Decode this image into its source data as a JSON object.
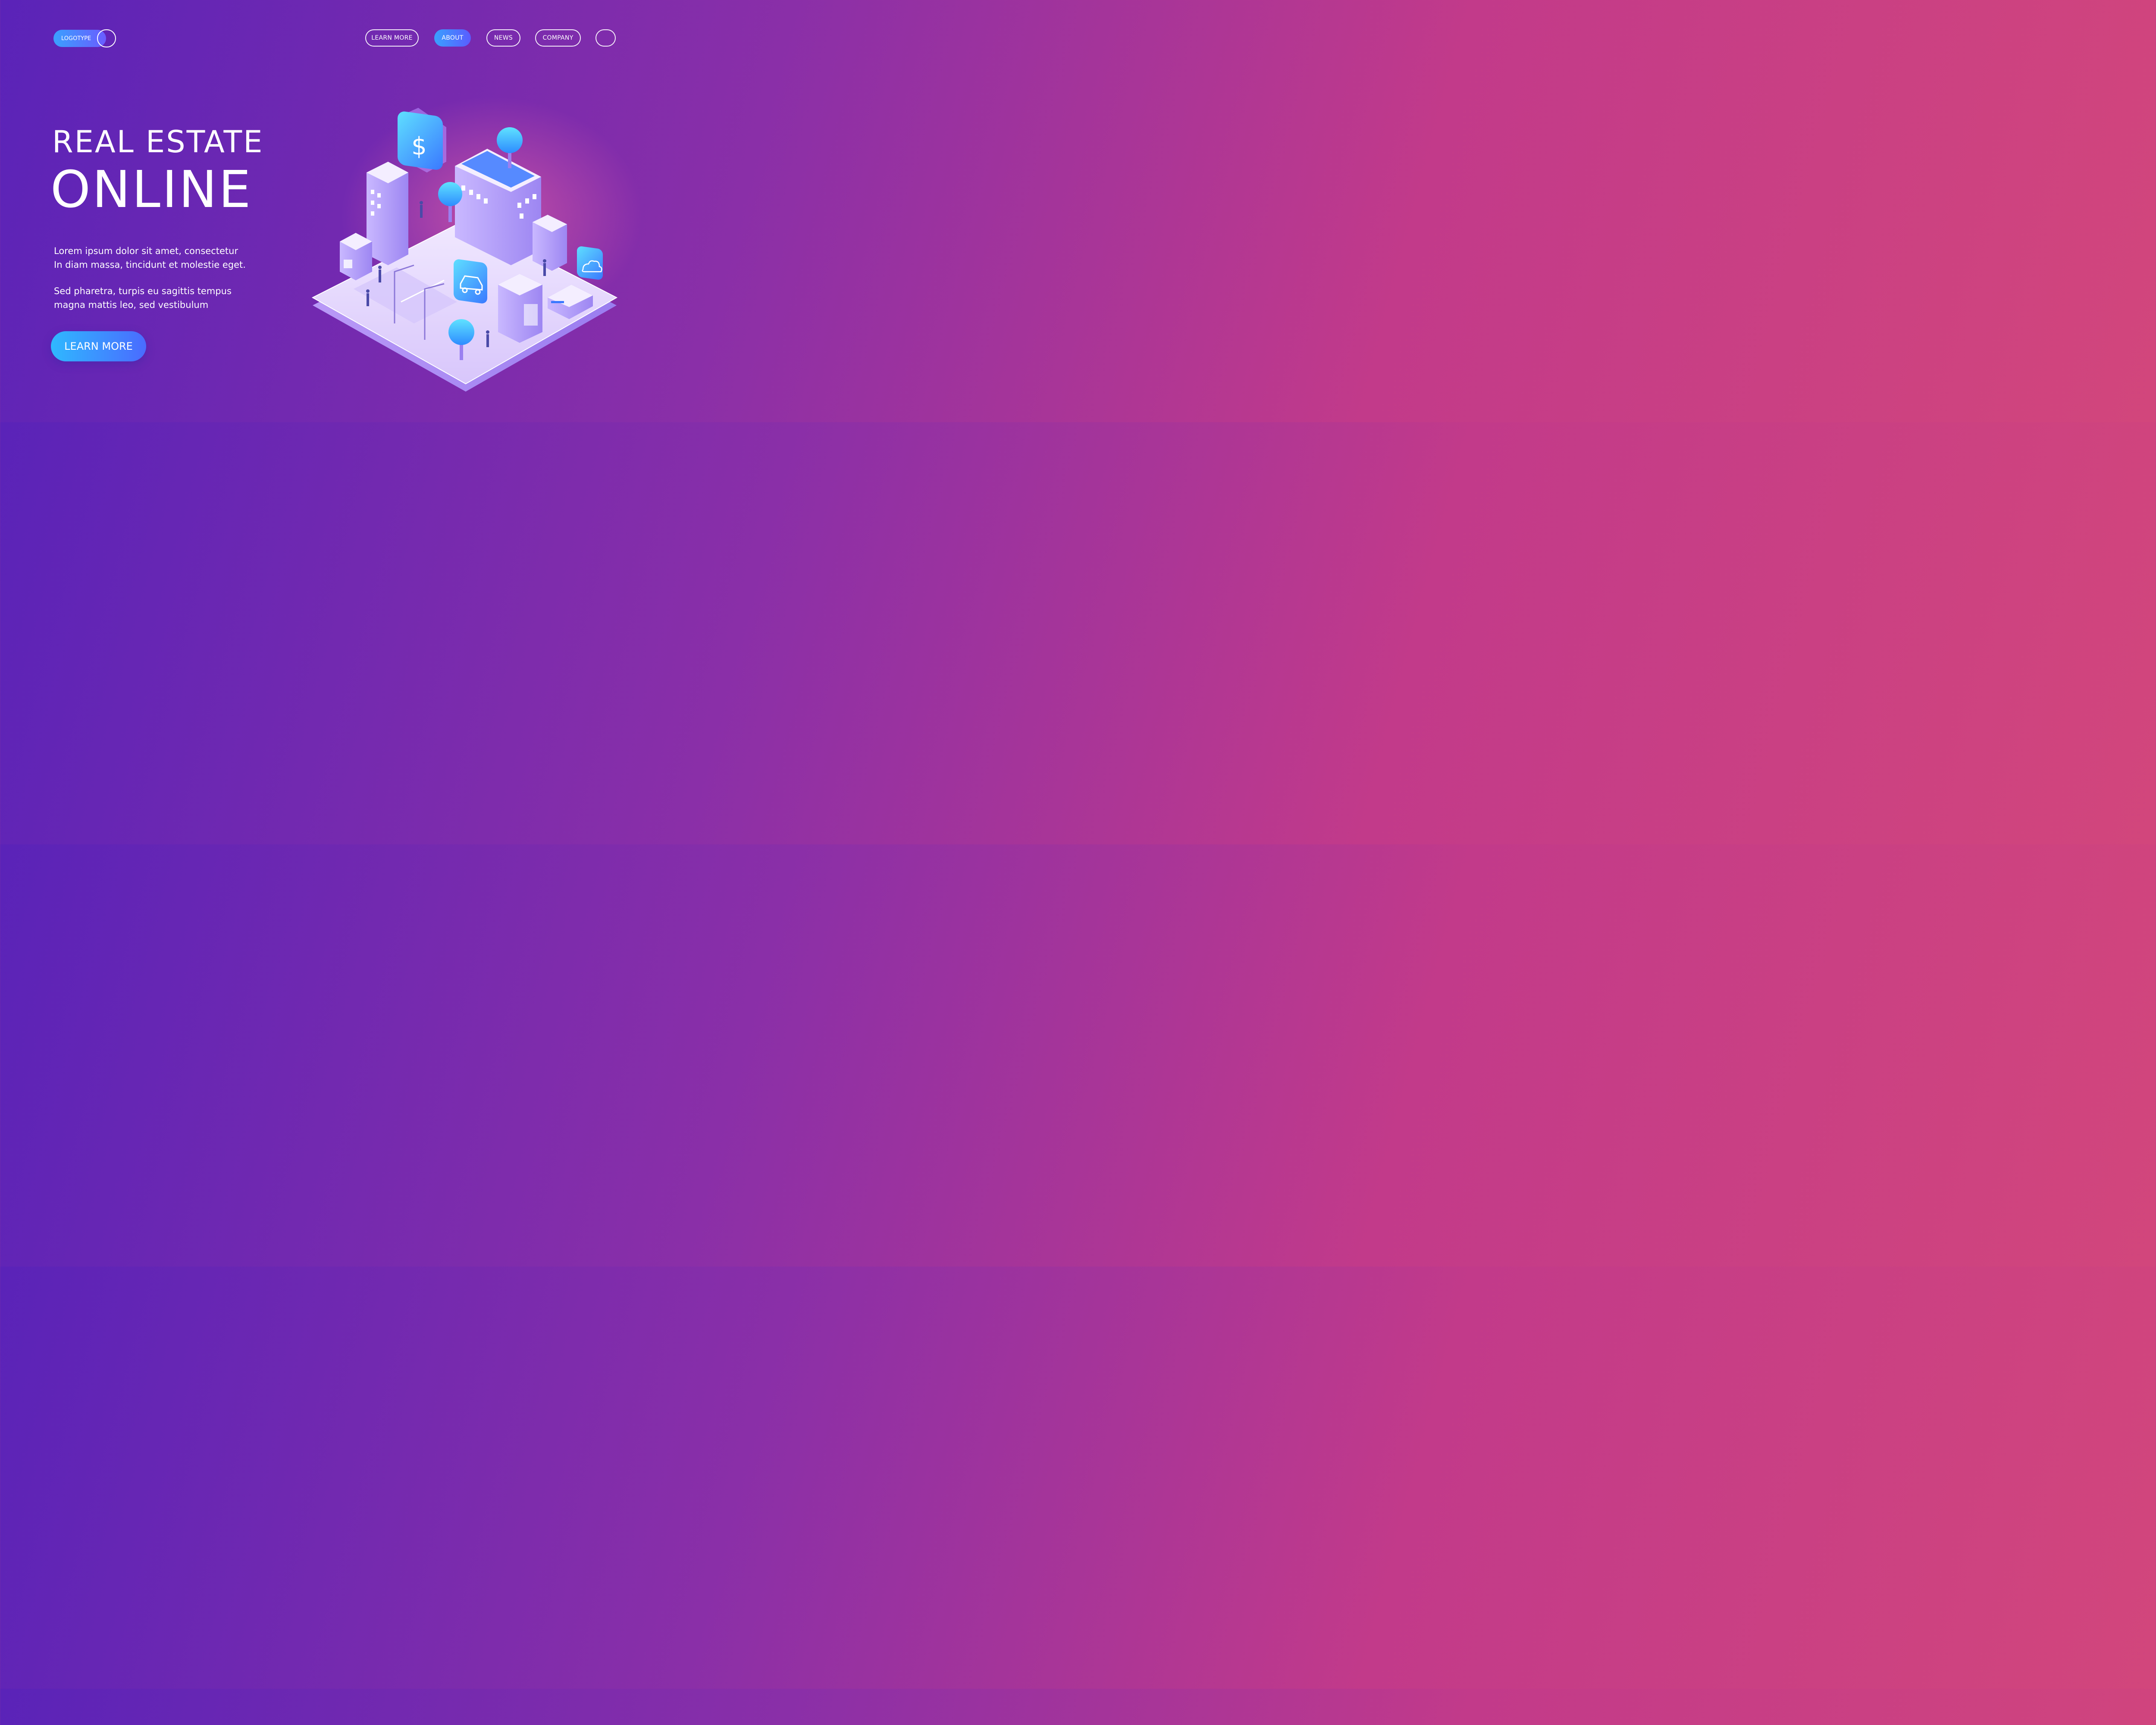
{
  "header": {
    "logo_label": "LOGOTYPE",
    "nav": [
      {
        "label": "LEARN MORE",
        "active": false
      },
      {
        "label": "ABOUT",
        "active": true
      },
      {
        "label": "NEWS",
        "active": false
      },
      {
        "label": "COMPANY",
        "active": false
      }
    ],
    "extra_button_label": ""
  },
  "hero": {
    "title_line1": "REAL ESTATE",
    "title_line2": "ONLINE",
    "paragraph1": [
      "Lorem ipsum dolor sit amet, consectetur",
      "In diam massa, tincidunt et molestie eget."
    ],
    "paragraph2": [
      "Sed pharetra, turpis eu sagittis tempus",
      "magna mattis leo, sed vestibulum"
    ],
    "cta_label": "LEARN MORE"
  },
  "illustration": {
    "icons": [
      "dollar-icon",
      "car-icon",
      "cloud-icon"
    ],
    "dollar_glyph": "$"
  },
  "colors": {
    "accent_start": "#3aa0ff",
    "accent_end": "#5a5cff",
    "background_left": "#5a23b8",
    "background_right": "#d2467c"
  }
}
